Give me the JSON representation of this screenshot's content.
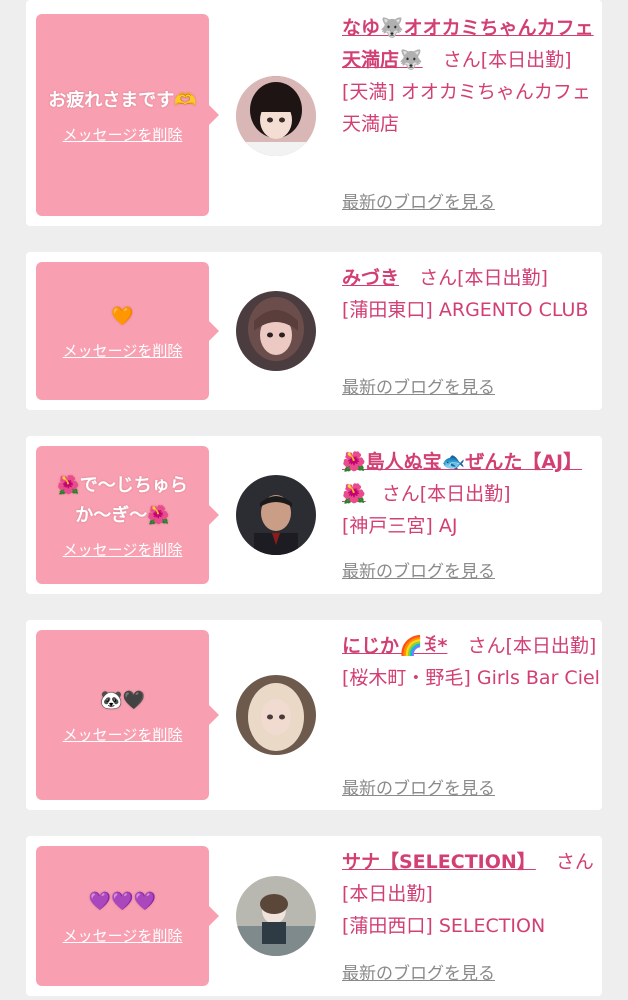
{
  "cards": [
    {
      "message": "お疲れさまです🫶",
      "delete_label": "メッセージを削除",
      "name": "なゆ🐺オオカミちゃんカフェ天満店🐺",
      "suffix": "さん",
      "status": "[本日出勤]",
      "shop": "[天満] オオカミちゃんカフェ天満店",
      "blog_label": "最新のブログを見る"
    },
    {
      "message": "🧡",
      "delete_label": "メッセージを削除",
      "name": "みづき",
      "suffix": "さん",
      "status": "[本日出勤]",
      "shop": "[蒲田東口] ARGENTO CLUB",
      "blog_label": "最新のブログを見る"
    },
    {
      "message": "🌺で〜じちゅらか〜ぎ〜🌺",
      "delete_label": "メッセージを削除",
      "name": "🌺島人ぬ宝🐟ぜんた【AJ】🌺",
      "suffix": "さん",
      "status": "[本日出勤]",
      "shop": "[神戸三宮] AJ",
      "blog_label": "最新のブログを見る"
    },
    {
      "message": "🐼🖤",
      "delete_label": "メッセージを削除",
      "name": "にじか🌈ꉂ*",
      "suffix": "さん",
      "status": "[本日出勤]",
      "shop": "[桜木町・野毛] Girls Bar Ciel",
      "blog_label": "最新のブログを見る"
    },
    {
      "message": "💜💜💜",
      "delete_label": "メッセージを削除",
      "name": "サナ【SELECTION】",
      "suffix": "さん",
      "status": "[本日出勤]",
      "shop": "[蒲田西口] SELECTION",
      "blog_label": "最新のブログを見る"
    }
  ],
  "colors": {
    "accent": "#d23f73",
    "bubble": "#f8a0b1",
    "background": "#eeeeee",
    "link_gray": "#8a8a8a"
  }
}
